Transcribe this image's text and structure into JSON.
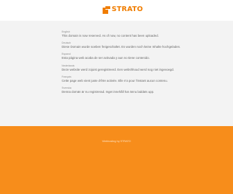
{
  "brand": {
    "logo_text": "STRATO",
    "accent_color": "#f07d00",
    "footer_color": "#f78d1b"
  },
  "languages": [
    {
      "name": "English",
      "message": "This domain is now reserved. As of now, no content has been uploaded."
    },
    {
      "name": "Deutsch",
      "message": "Diese Domain wurde soeben freigeschaltet. Es wurden noch keine Inhalte hochgeladen."
    },
    {
      "name": "Espanol",
      "message": "Esta página web acaba de ser activada y aun no tiene contenido."
    },
    {
      "name": "Nederlands",
      "message": "Deze website werd zojuist geregistreerd. Een webshhoud werd nog niet ingevoegd."
    },
    {
      "name": "Français",
      "message": "Cette page web vient juste d'être activée. Elle n'a pour l'instant aucun contenu."
    },
    {
      "name": "Svenska",
      "message": "Denna domän är nu registrerad. Inget innehåll har ännu laddats upp."
    }
  ],
  "footer": {
    "text": "Webhosting by STRATO"
  }
}
